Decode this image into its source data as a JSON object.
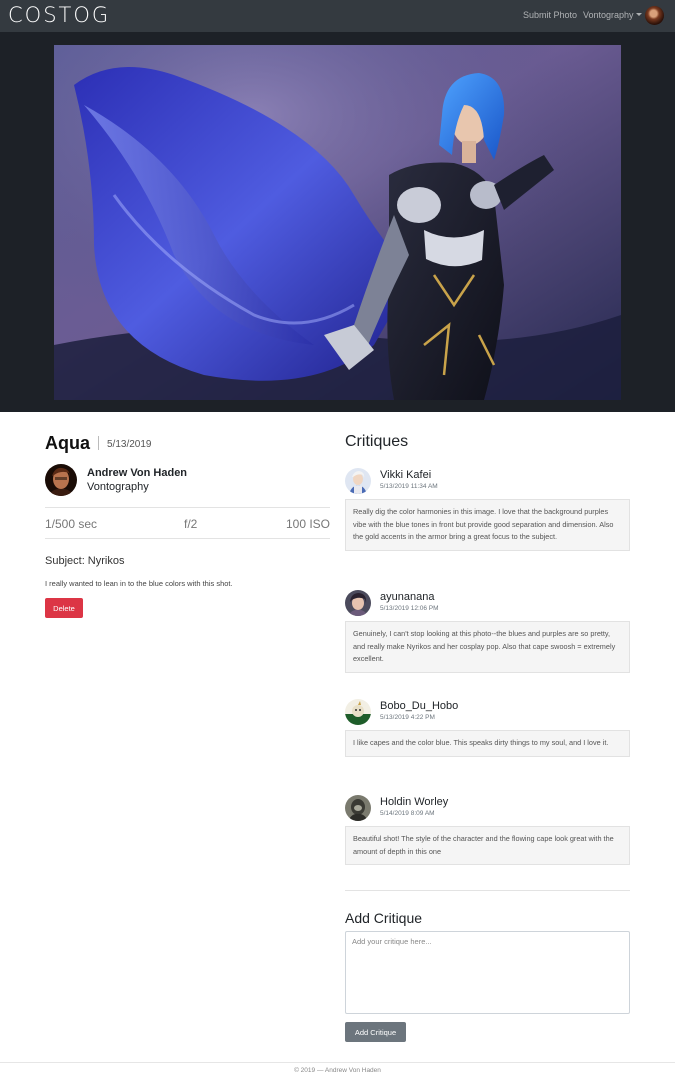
{
  "navbar": {
    "brand": "COSTOG",
    "submit_label": "Submit Photo",
    "user_label": "Vontography"
  },
  "photo": {
    "title": "Aqua",
    "date": "5/13/2019",
    "author_name": "Andrew Von Haden",
    "author_org": "Vontography",
    "shutter": "1/500 sec",
    "aperture": "f/2",
    "iso": "100 ISO",
    "subject": "Subject: Nyrikos",
    "description": "I really wanted to lean in to the blue colors with this shot.",
    "delete_label": "Delete"
  },
  "critiques": {
    "heading": "Critiques",
    "items": [
      {
        "name": "Vikki Kafei",
        "time": "5/13/2019 11:34 AM",
        "text": "Really dig the color harmonies in this image. I love that the background purples vibe with the blue tones in front but provide good separation and dimension. Also the gold accents in the armor bring a great focus to the subject."
      },
      {
        "name": "ayunanana",
        "time": "5/13/2019 12:06 PM",
        "text": "Genuinely, I can't stop looking at this photo--the blues and purples are so pretty, and really make Nyrikos and her cosplay pop. Also that cape swoosh = extremely excellent."
      },
      {
        "name": "Bobo_Du_Hobo",
        "time": "5/13/2019 4:22 PM",
        "text": "I like capes and the color blue. This speaks dirty things to my soul, and I love it."
      },
      {
        "name": "Holdin Worley",
        "time": "5/14/2019 8:09 AM",
        "text": "Beautiful shot! The style of the character and the flowing cape look great with the amount of depth in this one"
      }
    ]
  },
  "add_critique": {
    "heading": "Add Critique",
    "placeholder": "Add your critique here...",
    "button_label": "Add Critique"
  },
  "footer": {
    "text": "© 2019 — Andrew Von Haden"
  }
}
